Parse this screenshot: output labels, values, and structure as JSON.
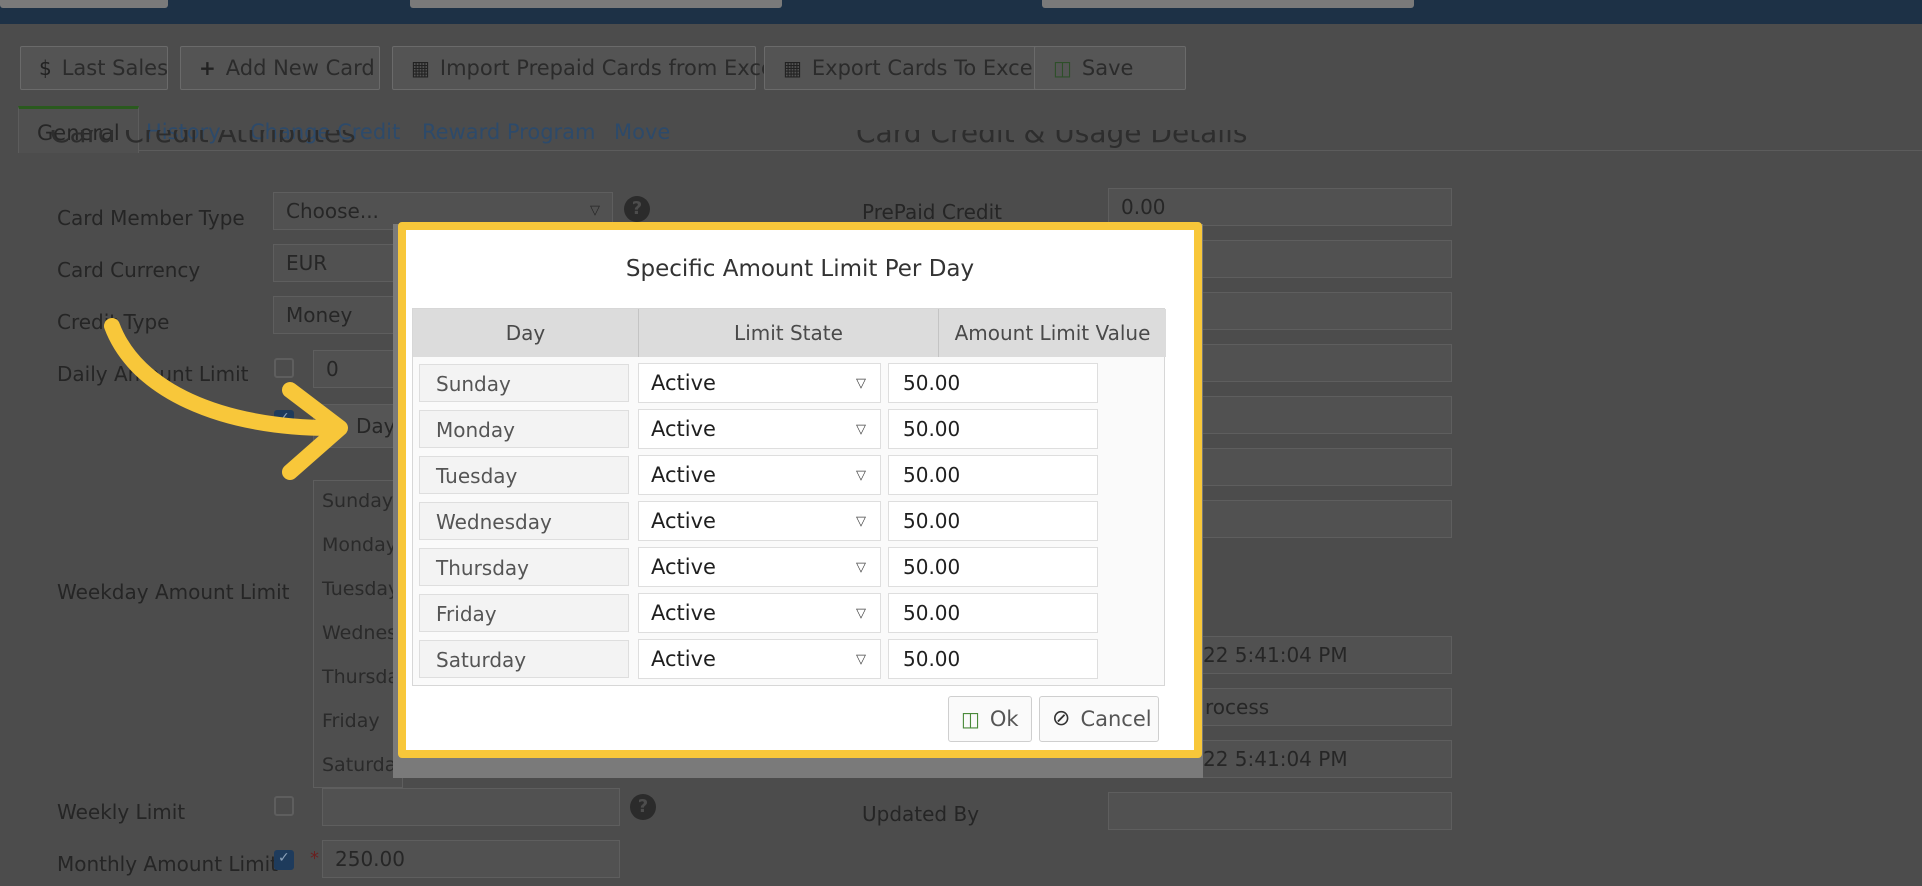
{
  "toolbar": {
    "last_sales": "Last Sales",
    "add_new_card": "Add New Card",
    "import_excel": "Import Prepaid Cards from Excel",
    "export_excel": "Export Cards To Excel",
    "save": "Save"
  },
  "tabs": [
    "General",
    "History",
    "Change Credit",
    "Reward Program",
    "Move"
  ],
  "active_tab": "General",
  "left_section": {
    "title": "Card Credit Attributes",
    "fields": {
      "card_member_type": {
        "label": "Card Member Type",
        "value": "Choose..."
      },
      "card_currency": {
        "label": "Card Currency",
        "value": "EUR"
      },
      "credit_type": {
        "label": "Credit Type",
        "value": "Money"
      },
      "daily_amount_limit": {
        "label": "Daily Amount Limit",
        "value": "0",
        "checked": false
      },
      "weekday_amount_limit": {
        "label": "Weekday Amount Limit",
        "checked": true,
        "column_header": "Day"
      },
      "weekly_limit": {
        "label": "Weekly Limit",
        "value": "",
        "checked": false
      },
      "monthly_amount_limit": {
        "label": "Monthly Amount Limit",
        "value": "250.00",
        "checked": true
      }
    },
    "background_days": [
      "Sunday",
      "Monday",
      "Tuesday",
      "Wednes",
      "Thursda",
      "Friday",
      "Saturda"
    ]
  },
  "right_section": {
    "title": "Card Credit & Usage Details",
    "prepaid_credit": {
      "label": "PrePaid Credit",
      "value": "0.00"
    },
    "date_1": "22 5:41:04 PM",
    "process_text": "rocess",
    "date_2": "22 5:41:04 PM",
    "updated_by": {
      "label": "Updated By",
      "value": ""
    }
  },
  "modal": {
    "title": "Specific Amount Limit Per Day",
    "columns": [
      "Day",
      "Limit State",
      "Amount Limit Value"
    ],
    "rows": [
      {
        "day": "Sunday",
        "state": "Active",
        "value": "50.00"
      },
      {
        "day": "Monday",
        "state": "Active",
        "value": "50.00"
      },
      {
        "day": "Tuesday",
        "state": "Active",
        "value": "50.00"
      },
      {
        "day": "Wednesday",
        "state": "Active",
        "value": "50.00"
      },
      {
        "day": "Thursday",
        "state": "Active",
        "value": "50.00"
      },
      {
        "day": "Friday",
        "state": "Active",
        "value": "50.00"
      },
      {
        "day": "Saturday",
        "state": "Active",
        "value": "50.00"
      }
    ],
    "ok_label": "Ok",
    "cancel_label": "Cancel"
  },
  "icons": {
    "last_sales": "dollar-icon",
    "add_new_card": "plus-icon",
    "import": "excel-file-icon",
    "export": "excel-file-icon",
    "save": "floppy-disk-icon",
    "help": "question-circle-icon",
    "dropdown": "caret-down-icon",
    "ok": "floppy-disk-icon",
    "cancel": "ban-icon",
    "annotation": "curved-arrow-icon"
  },
  "colors": {
    "highlight": "#f8c73a",
    "topbar": "#1d3146",
    "overlay": "#4c4c4c",
    "link": "#2d4a6a",
    "modal_bg": "#ffffff"
  }
}
